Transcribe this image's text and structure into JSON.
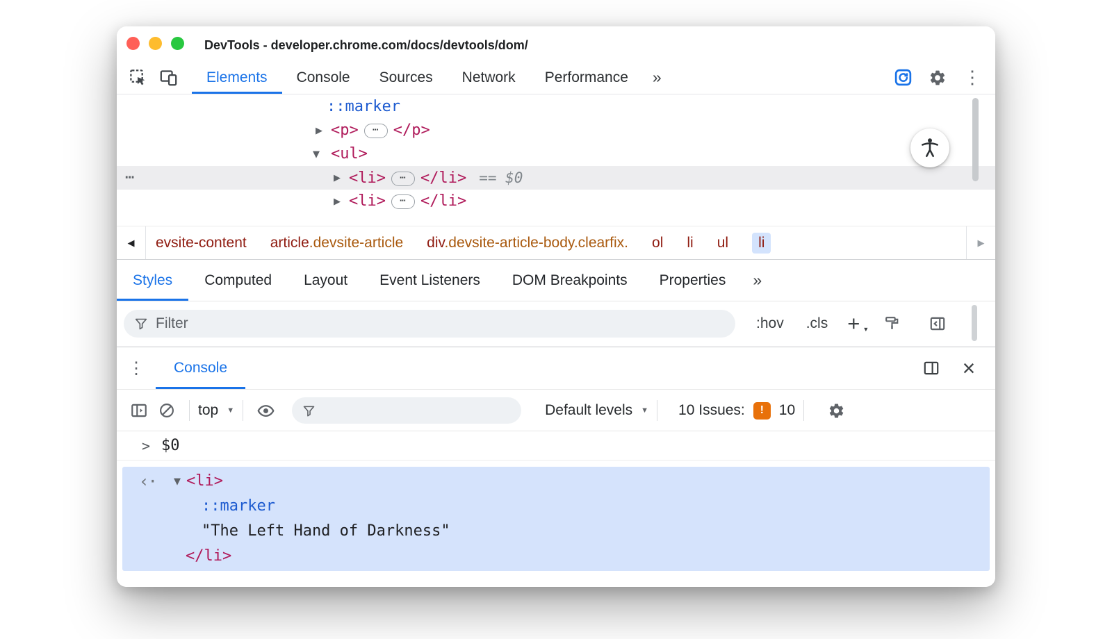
{
  "colors": {
    "accent_blue": "#1a73e8",
    "tag_crimson": "#b01b5b",
    "pseudo_blue": "#1d5bd0",
    "crumb_tag": "#8f1b10",
    "crumb_class": "#a9590e",
    "selection_blue_bg": "#d5e3fc",
    "issues_orange": "#e8710a"
  },
  "icons": {
    "expand": "▶",
    "collapse": "▼",
    "back": "◀",
    "forward": "▶",
    "more_tabs": "»",
    "overflow_menu": "⋮",
    "close": "×",
    "caret_down": "▼",
    "gutter_dots": "⋯",
    "node_dots": "⋯",
    "prompt_chevron": ">",
    "result_arrow": "‹·"
  },
  "titlebar": {
    "title": "DevTools - developer.chrome.com/docs/devtools/dom/"
  },
  "toolbar": {
    "tabs": [
      {
        "label": "Elements"
      },
      {
        "label": "Console"
      },
      {
        "label": "Sources"
      },
      {
        "label": "Network"
      },
      {
        "label": "Performance"
      }
    ]
  },
  "dom_tree": {
    "marker_row": {
      "text": "::marker"
    },
    "p_row": {
      "open": "<p>",
      "close": "</p>"
    },
    "ul_row": {
      "open": "<ul>"
    },
    "li_selected_row": {
      "open": "<li>",
      "close": "</li>",
      "suffix": "== $0"
    },
    "li_row": {
      "open": "<li>",
      "close": "</li>"
    }
  },
  "breadcrumbs": {
    "crumbs": [
      {
        "tag": "evsite-content",
        "cls": ""
      },
      {
        "tag": "article",
        "cls": ".devsite-article"
      },
      {
        "tag": "div",
        "cls": ".devsite-article-body.clearfix."
      },
      {
        "tag": "ol",
        "cls": ""
      },
      {
        "tag": "li",
        "cls": ""
      },
      {
        "tag": "ul",
        "cls": ""
      },
      {
        "tag": "li",
        "cls": ""
      }
    ]
  },
  "styles_pane": {
    "tabs": [
      {
        "label": "Styles"
      },
      {
        "label": "Computed"
      },
      {
        "label": "Layout"
      },
      {
        "label": "Event Listeners"
      },
      {
        "label": "DOM Breakpoints"
      },
      {
        "label": "Properties"
      }
    ],
    "filter_placeholder": "Filter",
    "hov_label": ":hov",
    "cls_label": ".cls",
    "plus_label": "+"
  },
  "console_drawer": {
    "tab_label": "Console",
    "context_label": "top",
    "levels_label": "Default levels",
    "issues_label": "10 Issues:",
    "issues_badge_glyph": "!",
    "issues_count": "10",
    "prompt_text": "$0",
    "result": {
      "li_open": "<li>",
      "marker": "::marker",
      "string_line": "\"The Left Hand of Darkness\"",
      "li_close": "</li>"
    }
  }
}
